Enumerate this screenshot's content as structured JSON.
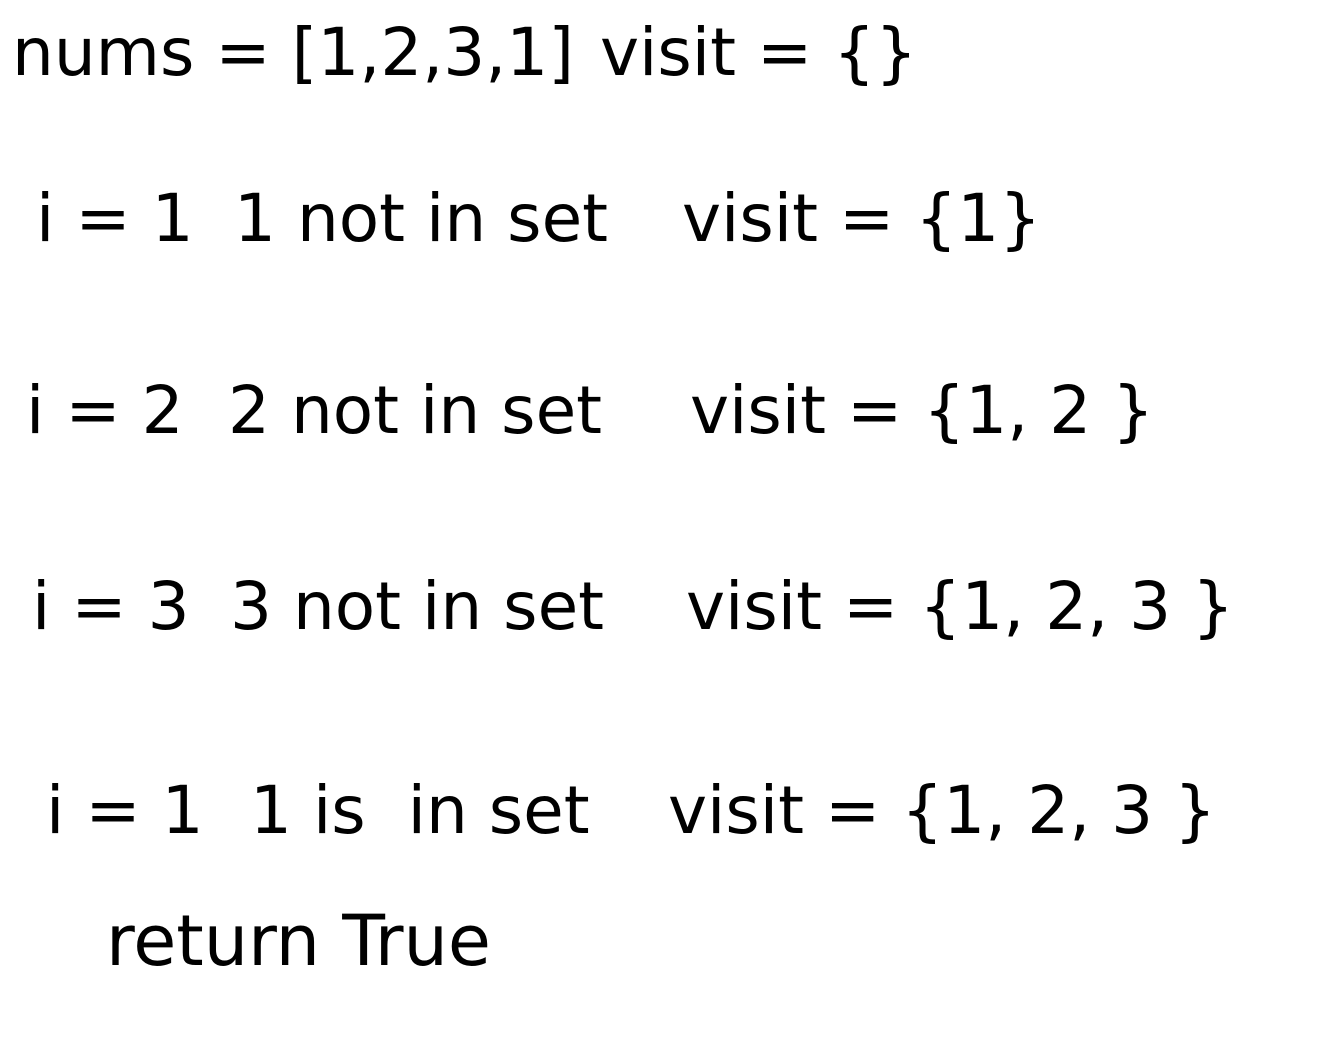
{
  "header": {
    "nums": "nums = [1,2,3,1]",
    "visit": "visit = {}"
  },
  "steps": [
    {
      "i": "i = 1",
      "check": "1 not in set",
      "visit": "visit = {1}"
    },
    {
      "i": "i = 2",
      "check": "2 not in set",
      "visit": "visit = {1, 2 }"
    },
    {
      "i": "i = 3",
      "check": "3 not in set",
      "visit": "visit = {1, 2, 3 }"
    },
    {
      "i": "i = 1",
      "check": "1 is  in set",
      "visit": "visit = {1, 2, 3 }"
    }
  ],
  "result": "return True"
}
